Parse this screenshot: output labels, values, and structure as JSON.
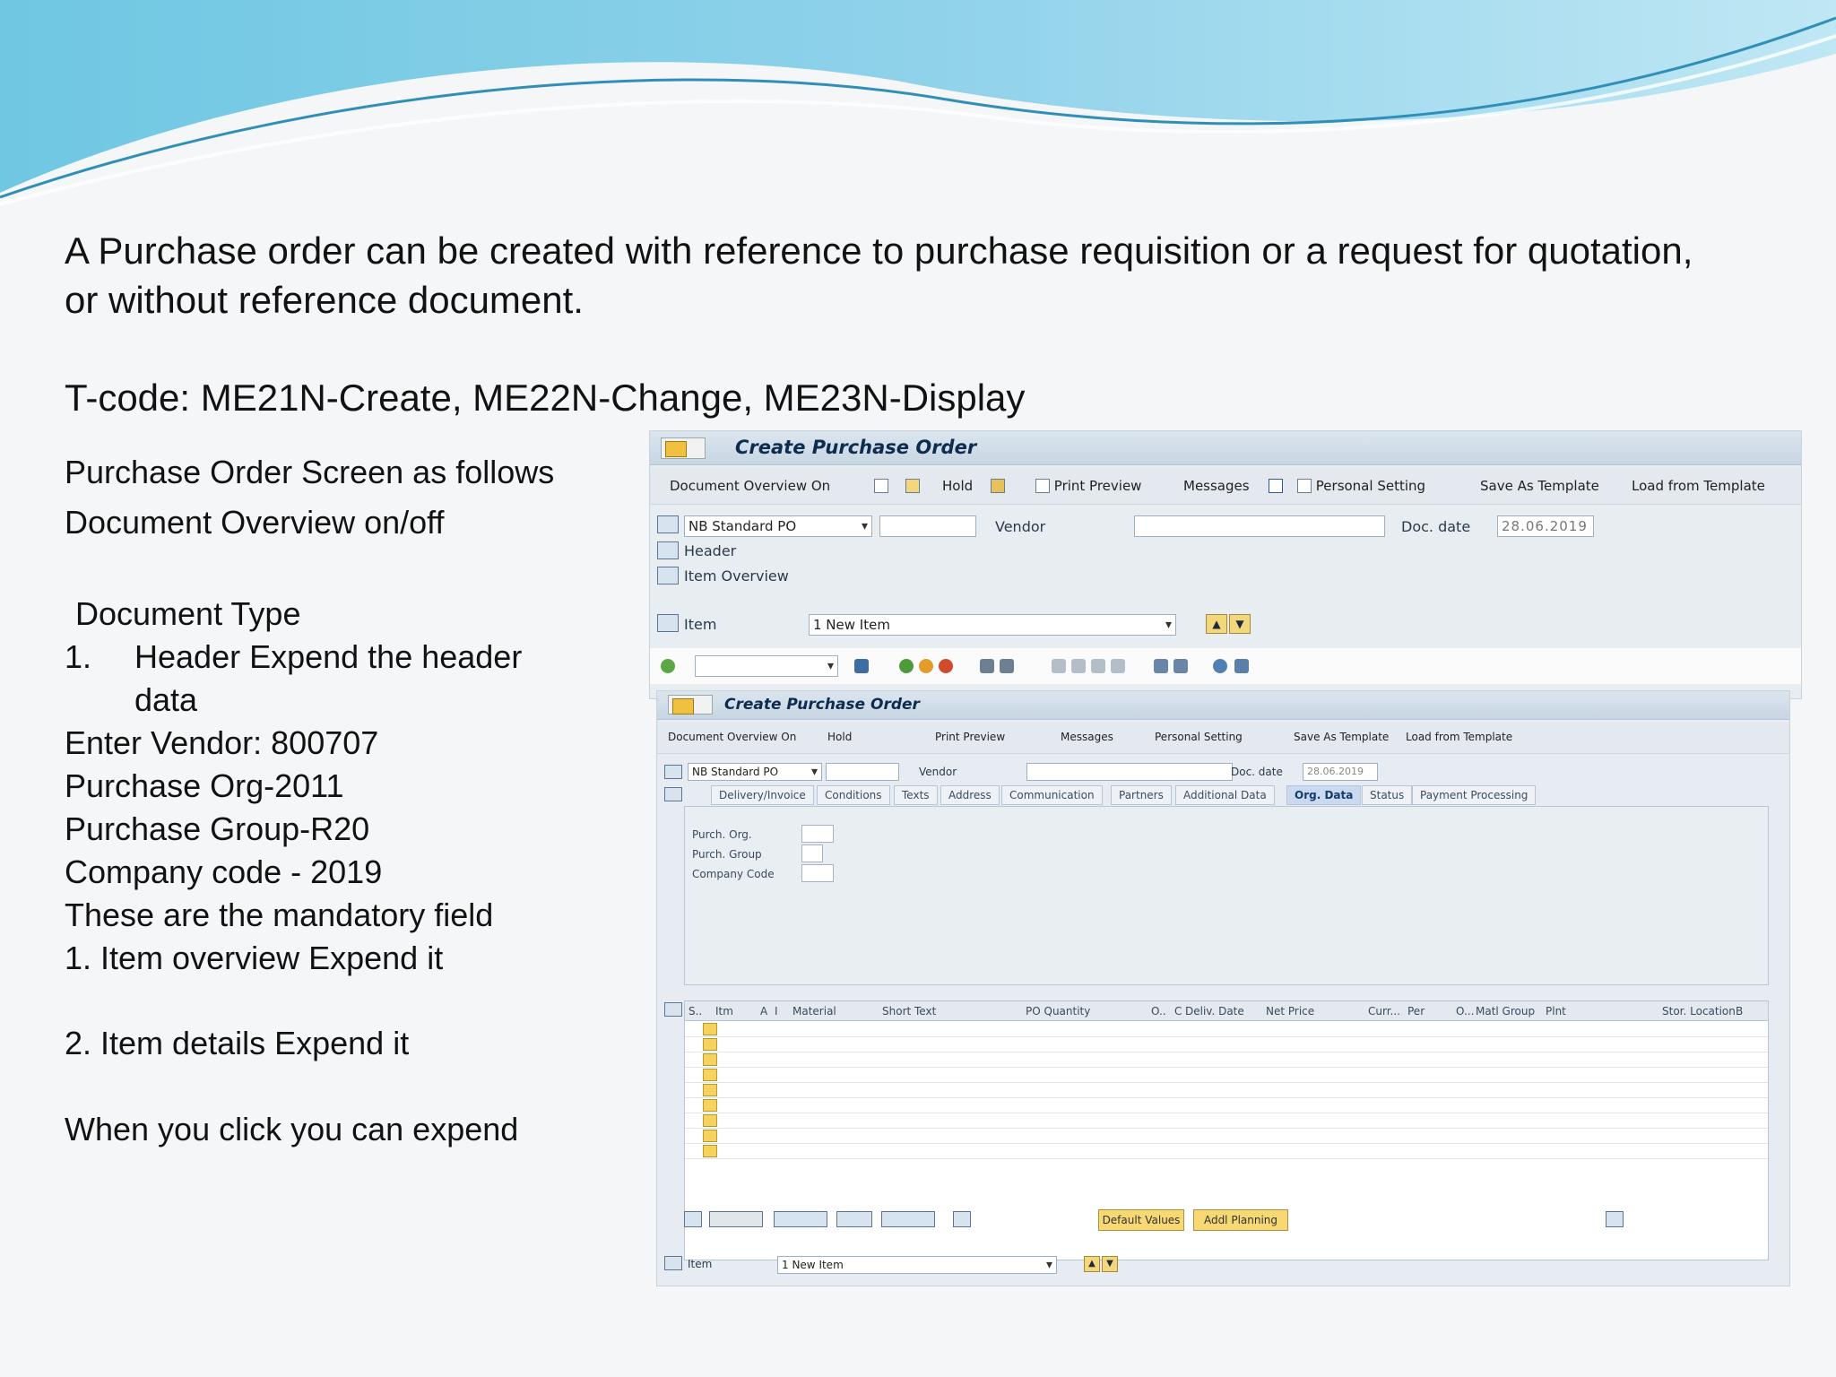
{
  "slide": {
    "intro": "A Purchase order can be created with reference to purchase requisition or a request for quotation, or without reference document.",
    "tcode": "T-code: ME21N-Create, ME22N-Change, ME23N-Display"
  },
  "notes": {
    "line1": "Purchase Order Screen as follows",
    "line2": "Document Overview on/off",
    "line3": "Document Type",
    "line4_num": "1.",
    "line4": "Header Expend the header",
    "line4b": "data",
    "line5": "Enter Vendor: 800707",
    "line6": "Purchase Org-2011",
    "line7": "Purchase Group-R20",
    "line8": "Company code - 2019",
    "line9": "These are the mandatory field",
    "line10": "1. Item overview Expend it",
    "line11": "2. Item details Expend it",
    "line12": "When you click you can expend"
  },
  "sap_top": {
    "title": "Create Purchase Order",
    "appbar": {
      "doc_overview": "Document Overview On",
      "hold": "Hold",
      "print_preview": "Print Preview",
      "messages": "Messages",
      "personal_setting": "Personal Setting",
      "save_template": "Save As Template",
      "load_template": "Load from Template"
    },
    "doc_type": "NB Standard PO",
    "vendor_label": "Vendor",
    "doc_date_label": "Doc. date",
    "doc_date": "28.06.2019",
    "header_label": "Header",
    "item_overview_label": "Item Overview",
    "item_label": "Item",
    "item_select": "1 New Item"
  },
  "sap_bottom": {
    "title": "Create Purchase Order",
    "appbar": {
      "doc_overview": "Document Overview On",
      "hold": "Hold",
      "print_preview": "Print Preview",
      "messages": "Messages",
      "personal_setting": "Personal Setting",
      "save_template": "Save As Template",
      "load_template": "Load from Template"
    },
    "doc_type": "NB Standard PO",
    "vendor_label": "Vendor",
    "doc_date_label": "Doc. date",
    "doc_date": "28.06.2019",
    "tabs": [
      "Delivery/Invoice",
      "Conditions",
      "Texts",
      "Address",
      "Communication",
      "Partners",
      "Additional Data",
      "Org. Data",
      "Status",
      "Payment Processing"
    ],
    "org_labels": {
      "purch_org": "Purch. Org.",
      "purch_group": "Purch. Group",
      "company_code": "Company Code"
    },
    "columns": [
      "S..",
      "Itm",
      "A",
      "I",
      "Material",
      "Short Text",
      "PO Quantity",
      "O..",
      "C",
      "Deliv. Date",
      "Net Price",
      "Curr...",
      "Per",
      "O...",
      "Matl Group",
      "Plnt",
      "Stor. Location",
      "B"
    ],
    "buttons": {
      "default_values": "Default Values",
      "addl_planning": "Addl Planning"
    },
    "item_label": "Item",
    "item_select": "1 New Item"
  },
  "colors": {
    "wave_dark": "#4fb3d9",
    "wave_light": "#a9def0",
    "panel": "#e8edf2"
  }
}
